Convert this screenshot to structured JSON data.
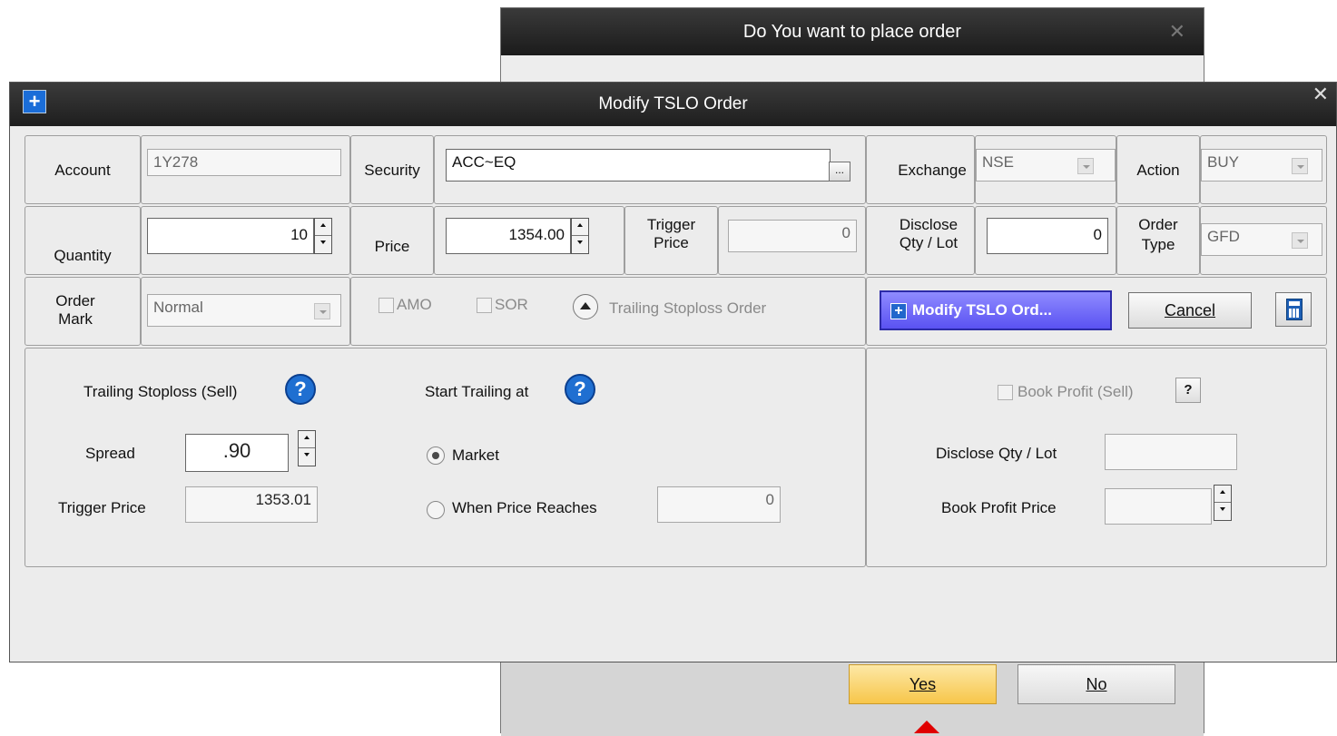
{
  "confirm": {
    "title": "Do You want to place order",
    "close_label": "✕",
    "yes_label": "Yes",
    "no_label": "No"
  },
  "modify": {
    "title": "Modify TSLO Order",
    "icon_label": "+",
    "close_label": "✕",
    "account": {
      "label": "Account",
      "value": "1Y278"
    },
    "security": {
      "label": "Security",
      "value": "ACC~EQ",
      "browse_label": "..."
    },
    "exchange": {
      "label": "Exchange",
      "value": "NSE"
    },
    "action": {
      "label": "Action",
      "value": "BUY"
    },
    "quantity": {
      "label": "Quantity",
      "value": "10"
    },
    "price": {
      "label": "Price",
      "value": "1354.00"
    },
    "trigger_price": {
      "label_line1": "Trigger",
      "label_line2": "Price",
      "value": "0"
    },
    "disclose": {
      "label_line1": "Disclose",
      "label_line2": "Qty / Lot",
      "value": "0"
    },
    "order_type": {
      "label_line1": "Order",
      "label_line2": "Type",
      "value": "GFD"
    },
    "order_mark": {
      "label_line1": "Order",
      "label_line2": "Mark",
      "value": "Normal"
    },
    "amo_label": "AMO",
    "sor_label": "SOR",
    "trailing_toggle_label": "Trailing Stoploss Order",
    "modify_button_label": "Modify TSLO Ord...",
    "cancel_label": "Cancel"
  },
  "trailing": {
    "title": "Trailing Stoploss (Sell)",
    "help_label": "?",
    "spread_label": "Spread",
    "spread_value": ".90",
    "trigger_label": "Trigger Price",
    "trigger_value": "1353.01",
    "start_label": "Start Trailing at",
    "market_label": "Market",
    "when_label": "When Price Reaches",
    "when_value": "0"
  },
  "book_profit": {
    "check_label": "Book Profit (Sell)",
    "help_label": "?",
    "disclose_label": "Disclose Qty / Lot",
    "disclose_value": "",
    "price_label": "Book Profit Price",
    "price_value": ""
  }
}
